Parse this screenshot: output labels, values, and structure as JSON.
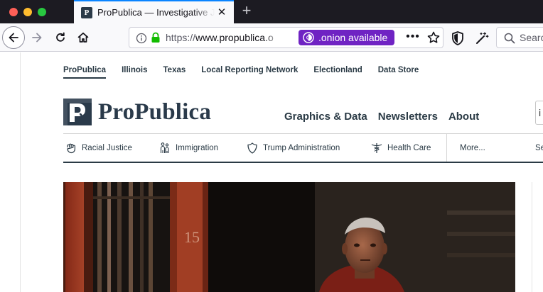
{
  "window": {
    "controls": [
      "close",
      "minimize",
      "maximize"
    ]
  },
  "tab": {
    "title": "ProPublica — Investigative Journalism and News in the Public Interest",
    "favicon_letter": "P",
    "close_glyph": "✕",
    "new_tab_glyph": "+"
  },
  "toolbar": {
    "url_scheme": "https://",
    "url_host": "www.propublica.o",
    "onion_label": ".onion available",
    "more_glyph": "•••",
    "search_placeholder": "Search",
    "colors": {
      "onion_badge": "#6f23c3",
      "lock": "#12bc00",
      "tab_accent": "#0a84ff"
    }
  },
  "site": {
    "top_nav": [
      {
        "label": "ProPublica",
        "active": true
      },
      {
        "label": "Illinois",
        "active": false
      },
      {
        "label": "Texas",
        "active": false
      },
      {
        "label": "Local Reporting Network",
        "active": false
      },
      {
        "label": "Electionland",
        "active": false
      },
      {
        "label": "Data Store",
        "active": false
      }
    ],
    "logo_text": "ProPublica",
    "main_nav": [
      "Graphics & Data",
      "Newsletters",
      "About"
    ],
    "search_fragment": "i",
    "topics": [
      {
        "label": "Racial Justice",
        "icon": "fist-icon"
      },
      {
        "label": "Immigration",
        "icon": "people-icon"
      },
      {
        "label": "Trump Administration",
        "icon": "shield-icon"
      },
      {
        "label": "Health Care",
        "icon": "caduceus-icon"
      },
      {
        "label": "More...",
        "icon": ""
      },
      {
        "label": "Se",
        "icon": ""
      }
    ],
    "hero_signage": "15",
    "colors": {
      "brand": "#2a3a45"
    }
  }
}
